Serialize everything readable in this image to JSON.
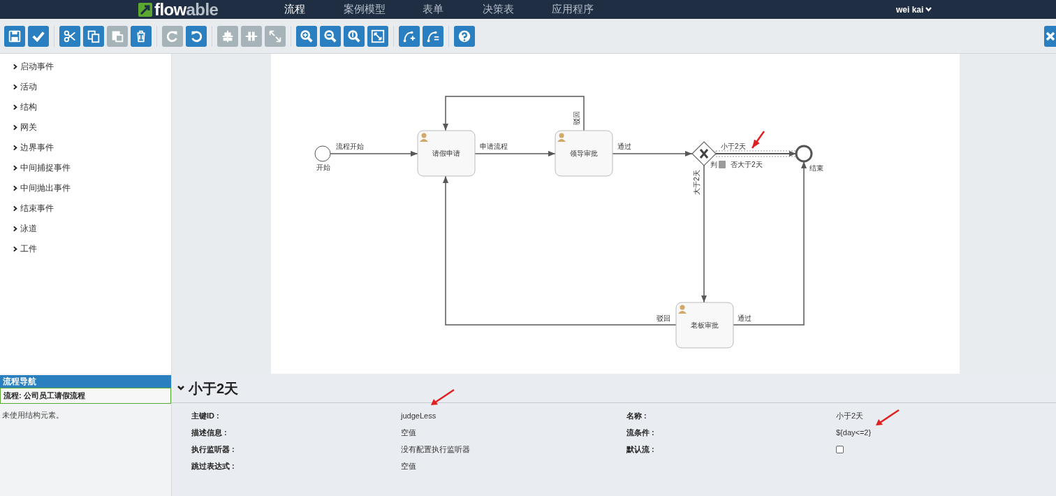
{
  "navbar": {
    "logo": [
      "flow",
      "able"
    ],
    "tabs": [
      {
        "label": "流程",
        "selected": true
      },
      {
        "label": "案例模型",
        "selected": false
      },
      {
        "label": "表单",
        "selected": false
      },
      {
        "label": "决策表",
        "selected": false
      },
      {
        "label": "应用程序",
        "selected": false
      }
    ],
    "user": "wei kai"
  },
  "toolbar": {
    "groups": [
      [
        {
          "kind": "save",
          "disabled": false
        },
        {
          "kind": "validate",
          "disabled": false
        }
      ],
      [
        {
          "kind": "cut",
          "disabled": false
        },
        {
          "kind": "copy",
          "disabled": false
        },
        {
          "kind": "paste",
          "disabled": true
        },
        {
          "kind": "delete",
          "disabled": false
        }
      ],
      [
        {
          "kind": "redo",
          "disabled": true
        },
        {
          "kind": "undo",
          "disabled": false
        }
      ],
      [
        {
          "kind": "align",
          "disabled": true
        },
        {
          "kind": "same-size",
          "disabled": true
        },
        {
          "kind": "resize",
          "disabled": true
        }
      ],
      [
        {
          "kind": "zoom-in",
          "disabled": false
        },
        {
          "kind": "zoom-out",
          "disabled": false
        },
        {
          "kind": "zoom-actual",
          "disabled": false
        },
        {
          "kind": "zoom-fit",
          "disabled": false
        }
      ],
      [
        {
          "kind": "bend-add",
          "disabled": false
        },
        {
          "kind": "bend-remove",
          "disabled": false
        }
      ],
      [
        {
          "kind": "help",
          "disabled": false
        }
      ]
    ],
    "close": true
  },
  "palette": [
    {
      "label": "启动事件",
      "expanded": false
    },
    {
      "label": "活动",
      "expanded": false
    },
    {
      "label": "结构",
      "expanded": false
    },
    {
      "label": "网关",
      "expanded": false
    },
    {
      "label": "边界事件",
      "expanded": false
    },
    {
      "label": "中间捕捉事件",
      "expanded": false
    },
    {
      "label": "中间抛出事件",
      "expanded": false
    },
    {
      "label": "结束事件",
      "expanded": false
    },
    {
      "label": "泳道",
      "expanded": false
    },
    {
      "label": "工件",
      "expanded": false
    }
  ],
  "diagram": {
    "nodes": [
      {
        "kind": "start",
        "label": "开始"
      },
      {
        "kind": "user-task",
        "label": "请假申请"
      },
      {
        "kind": "user-task",
        "label": "领导审批"
      },
      {
        "kind": "gateway",
        "label_fragments": [
          "判",
          "否大于2天"
        ]
      },
      {
        "kind": "end",
        "label": "结束"
      },
      {
        "kind": "user-task",
        "label": "老板审批"
      }
    ],
    "edges": [
      {
        "label": "流程开始",
        "selected": false
      },
      {
        "label": "申请流程",
        "selected": false
      },
      {
        "label": "通过",
        "selected": false
      },
      {
        "label": "小于2天",
        "selected": true
      },
      {
        "label": "大于2天",
        "selected": false
      },
      {
        "label": "驳回",
        "selected": false
      },
      {
        "label": "驳回",
        "selected": false
      },
      {
        "label": "通过",
        "selected": false
      }
    ]
  },
  "navigator": {
    "title": "流程导航",
    "item": "流程: 公司员工请假流程",
    "note": "未使用结构元素。"
  },
  "properties": {
    "title": "小于2天",
    "expanded": true,
    "left": [
      {
        "label": "主键ID :",
        "value": "judgeLess"
      },
      {
        "label": "描述信息 :",
        "value": "空值"
      },
      {
        "label": "执行监听器 :",
        "value": "没有配置执行监听器"
      },
      {
        "label": "跳过表达式 :",
        "value": "空值"
      }
    ],
    "right": [
      {
        "kind": "text",
        "label": "名称 :",
        "value": "小于2天"
      },
      {
        "kind": "text",
        "label": "流条件 :",
        "value": "${day<=2}"
      },
      {
        "kind": "checkbox",
        "label": "默认流 :",
        "checked": false
      }
    ]
  }
}
